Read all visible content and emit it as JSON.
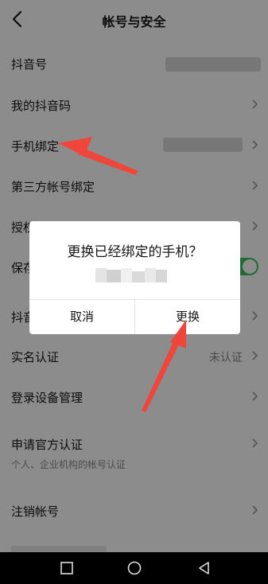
{
  "header": {
    "title": "帐号与安全"
  },
  "rows": [
    {
      "label": "抖音号"
    },
    {
      "label": "我的抖音码"
    },
    {
      "label": "手机绑定"
    },
    {
      "label": "第三方帐号绑定"
    },
    {
      "label": "授权"
    },
    {
      "label": "保存"
    },
    {
      "label": "抖音"
    },
    {
      "label": "实名认证",
      "value": "未认证"
    },
    {
      "label": "登录设备管理"
    },
    {
      "label": "申请官方认证",
      "sub": "个人、企业机构的帐号认证"
    },
    {
      "label": "注销帐号"
    }
  ],
  "dialog": {
    "title": "更换已经绑定的手机？",
    "cancel_label": "取消",
    "confirm_label": "更换"
  },
  "colors": {
    "accent_green": "#35c35e",
    "annotation_red": "#f0453a"
  },
  "icons": {
    "back": "chevron-left-icon",
    "nav": [
      "square-icon",
      "circle-icon",
      "triangle-back-icon"
    ]
  }
}
